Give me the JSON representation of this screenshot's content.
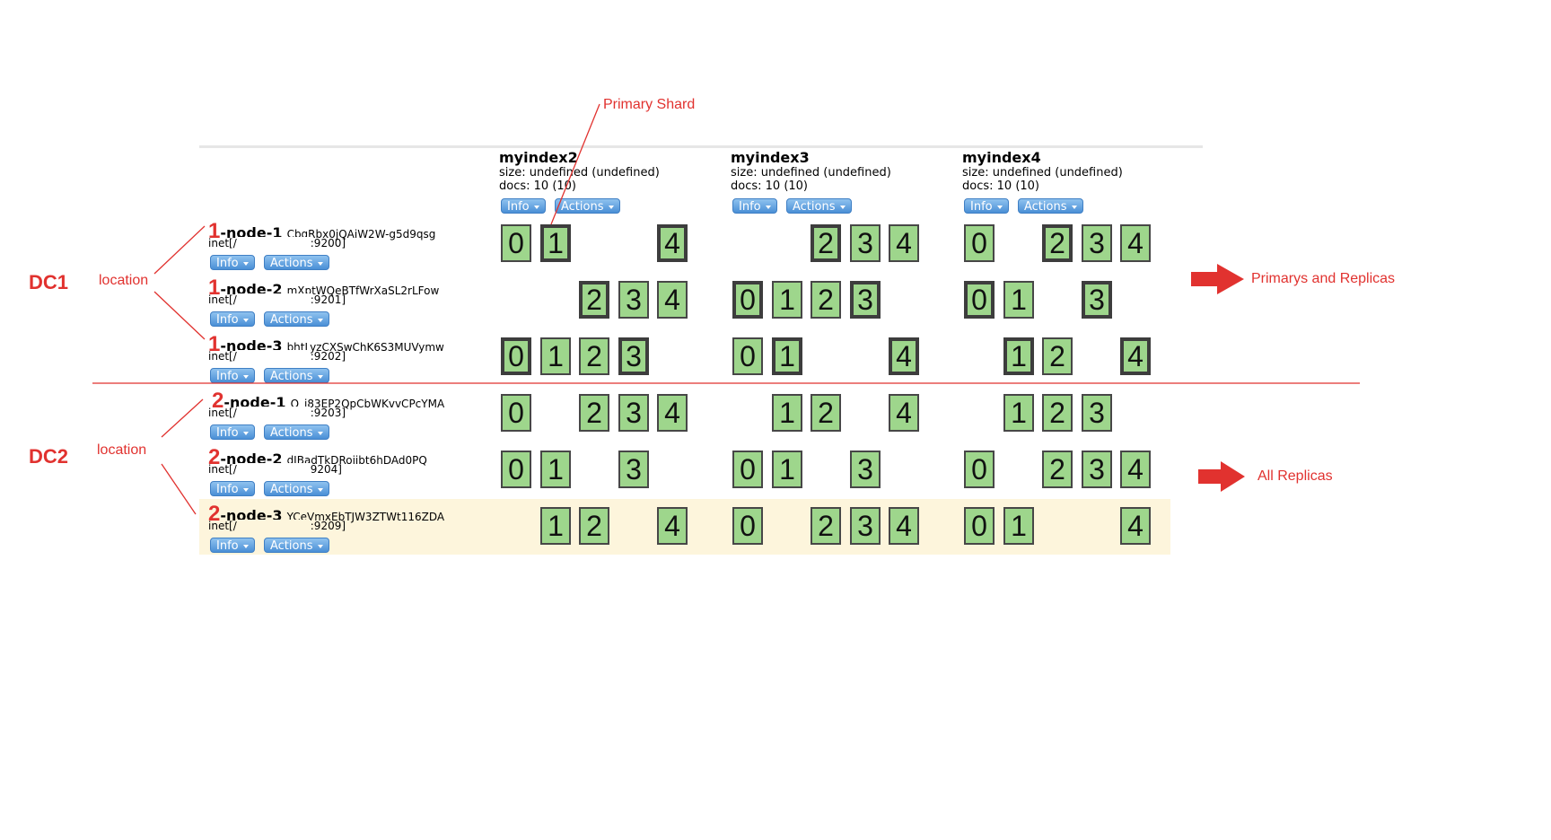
{
  "indices": [
    {
      "name": "myindex2",
      "size": "size: undefined (undefined)",
      "docs": "docs: 10 (10)",
      "info": "Info",
      "actions": "Actions"
    },
    {
      "name": "myindex3",
      "size": "size: undefined (undefined)",
      "docs": "docs: 10 (10)",
      "info": "Info",
      "actions": "Actions"
    },
    {
      "name": "myindex4",
      "size": "size: undefined (undefined)",
      "docs": "docs: 10 (10)",
      "info": "Info",
      "actions": "Actions"
    }
  ],
  "nodes": [
    {
      "num": "1",
      "name": "-node-1",
      "id": "CbqRbx0jQAiW2W-g5d9qsg",
      "inet_prefix": "inet[/",
      "inet_suffix": ":9200]",
      "info": "Info",
      "actions": "Actions"
    },
    {
      "num": "1",
      "name": "-node-2",
      "id": "mXptWQeBTfWrXaSL2rLFow",
      "inet_prefix": "inet[/",
      "inet_suffix": ":9201]",
      "info": "Info",
      "actions": "Actions"
    },
    {
      "num": "1",
      "name": "-node-3",
      "id": "bhtLyzCXSwChK6S3MUVymw",
      "inet_prefix": "inet[/",
      "inet_suffix": ":9202]",
      "info": "Info",
      "actions": "Actions"
    },
    {
      "num": "2",
      "name": "-node-1",
      "id": "Q_i83EP2QpCbWKvvCPcYMA",
      "inet_prefix": "inet[/",
      "inet_suffix": ":9203]",
      "info": "Info",
      "actions": "Actions"
    },
    {
      "num": "2",
      "name": "-node-2",
      "id": "dJBadTkDRoiibt6hDAd0PQ",
      "inet_prefix": "inet[/",
      "inet_suffix": "9204]",
      "info": "Info",
      "actions": "Actions"
    },
    {
      "num": "2",
      "name": "-node-3",
      "id": "YCeVmxEbTJW3ZTWt116ZDA",
      "inet_prefix": "inet[/",
      "inet_suffix": ":9209]",
      "info": "Info",
      "actions": "Actions"
    }
  ],
  "shards": [
    [
      [
        {
          "s": "0",
          "p": false
        },
        {
          "s": "1",
          "p": true
        },
        {
          "s": "4",
          "p": true
        }
      ],
      [
        {
          "s": "2",
          "p": true
        },
        {
          "s": "3",
          "p": false
        },
        {
          "s": "4",
          "p": false
        }
      ],
      [
        {
          "s": "0",
          "p": false
        },
        {
          "s": "2",
          "p": true
        },
        {
          "s": "3",
          "p": false
        },
        {
          "s": "4",
          "p": false
        }
      ]
    ],
    [
      [
        {
          "s": "2",
          "p": true
        },
        {
          "s": "3",
          "p": false
        },
        {
          "s": "4",
          "p": false
        }
      ],
      [
        {
          "s": "0",
          "p": true
        },
        {
          "s": "1",
          "p": false
        },
        {
          "s": "2",
          "p": false
        },
        {
          "s": "3",
          "p": true
        }
      ],
      [
        {
          "s": "0",
          "p": true
        },
        {
          "s": "1",
          "p": false
        },
        {
          "s": "3",
          "p": true
        }
      ]
    ],
    [
      [
        {
          "s": "0",
          "p": true
        },
        {
          "s": "1",
          "p": false
        },
        {
          "s": "2",
          "p": false
        },
        {
          "s": "3",
          "p": true
        }
      ],
      [
        {
          "s": "0",
          "p": false
        },
        {
          "s": "1",
          "p": true
        },
        {
          "s": "4",
          "p": true
        }
      ],
      [
        {
          "s": "1",
          "p": true
        },
        {
          "s": "2",
          "p": false
        },
        {
          "s": "4",
          "p": true
        }
      ]
    ],
    [
      [
        {
          "s": "0",
          "p": false
        },
        {
          "s": "2",
          "p": false
        },
        {
          "s": "3",
          "p": false
        },
        {
          "s": "4",
          "p": false
        }
      ],
      [
        {
          "s": "1",
          "p": false
        },
        {
          "s": "2",
          "p": false
        },
        {
          "s": "4",
          "p": false
        }
      ],
      [
        {
          "s": "1",
          "p": false
        },
        {
          "s": "2",
          "p": false
        },
        {
          "s": "3",
          "p": false
        }
      ]
    ],
    [
      [
        {
          "s": "0",
          "p": false
        },
        {
          "s": "1",
          "p": false
        },
        {
          "s": "3",
          "p": false
        }
      ],
      [
        {
          "s": "0",
          "p": false
        },
        {
          "s": "1",
          "p": false
        },
        {
          "s": "3",
          "p": false
        }
      ],
      [
        {
          "s": "0",
          "p": false
        },
        {
          "s": "2",
          "p": false
        },
        {
          "s": "3",
          "p": false
        },
        {
          "s": "4",
          "p": false
        }
      ]
    ],
    [
      [
        {
          "s": "1",
          "p": false
        },
        {
          "s": "2",
          "p": false
        },
        {
          "s": "4",
          "p": false
        }
      ],
      [
        {
          "s": "0",
          "p": false
        },
        {
          "s": "2",
          "p": false
        },
        {
          "s": "3",
          "p": false
        },
        {
          "s": "4",
          "p": false
        }
      ],
      [
        {
          "s": "0",
          "p": false
        },
        {
          "s": "1",
          "p": false
        },
        {
          "s": "4",
          "p": false
        }
      ]
    ]
  ],
  "annotations": {
    "primary_shard": "Primary Shard",
    "dc1": "DC1",
    "dc2": "DC2",
    "location1": "location",
    "location2": "location",
    "primarys_and_replicas": "Primarys and Replicas",
    "all_replicas": "All Replicas"
  },
  "colors": {
    "annotation_red": "#e1322f",
    "shard_green": "#9ed68c",
    "button_blue": "#4a8fd6",
    "highlight_row": "#fdf5dc"
  }
}
